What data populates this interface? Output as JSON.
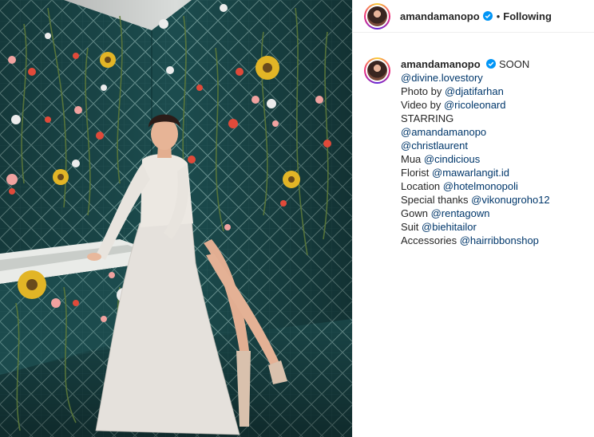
{
  "post": {
    "username": "amandamanopo",
    "follow_label": "Following",
    "separator": "•",
    "verified_icon": "verified-badge-icon",
    "accent_color": "#0095f6",
    "link_color": "#00376b"
  },
  "caption": {
    "username": "amandamanopo",
    "first_text": "SOON",
    "lines": [
      {
        "prefix": "",
        "link": "@divine.lovestory"
      },
      {
        "prefix": "Photo by ",
        "link": "@djatifarhan"
      },
      {
        "prefix": "Video by ",
        "link": "@ricoleonard"
      },
      {
        "prefix": "STARRING",
        "link": ""
      },
      {
        "prefix": "",
        "link": "@amandamanopo"
      },
      {
        "prefix": "",
        "link": "@christlaurent"
      },
      {
        "prefix": "Mua ",
        "link": "@cindicious"
      },
      {
        "prefix": "Florist ",
        "link": "@mawarlangit.id"
      },
      {
        "prefix": "Location ",
        "link": "@hotelmonopoli"
      },
      {
        "prefix": "Special thanks ",
        "link": "@vikonugroho12"
      },
      {
        "prefix": "Gown ",
        "link": "@rentagown"
      },
      {
        "prefix": "Suit ",
        "link": "@biehitailor"
      },
      {
        "prefix": "Accessories ",
        "link": "@hairribbonshop"
      }
    ]
  }
}
